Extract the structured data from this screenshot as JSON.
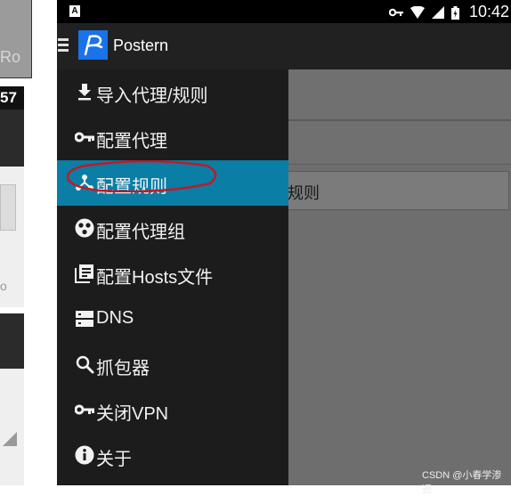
{
  "background_fragments": {
    "top_text": "Ro",
    "time_fragment": "57",
    "mid_text": "o"
  },
  "status_bar": {
    "notification_icon": "A",
    "icons": [
      "key-icon",
      "wifi-icon",
      "signal-icon",
      "battery-icon"
    ],
    "time": "10:42"
  },
  "app_bar": {
    "menu_icon": "hamburger-icon",
    "logo_icon": "postern-logo",
    "title": "Postern"
  },
  "drawer": {
    "items": [
      {
        "label": "导入代理/规则",
        "icon": "download-icon"
      },
      {
        "label": "配置代理",
        "icon": "key-icon"
      },
      {
        "label": "配置规则",
        "icon": "rules-icon",
        "selected": true
      },
      {
        "label": "配置代理组",
        "icon": "proxy-group-icon"
      },
      {
        "label": "配置Hosts文件",
        "icon": "hosts-file-icon"
      },
      {
        "label": "DNS",
        "icon": "dns-icon"
      },
      {
        "label": "抓包器",
        "icon": "search-icon"
      },
      {
        "label": "关闭VPN",
        "icon": "key-icon"
      },
      {
        "label": "关于",
        "icon": "info-icon"
      }
    ]
  },
  "background_content": {
    "rules_text": "规则"
  },
  "watermark": "CSDN @小春学渗透",
  "colors": {
    "selected_item": "#0a7ea4",
    "drawer_bg": "#1c1c1c",
    "app_bar": "#212121",
    "logo_blue": "#1a73e8",
    "annotation_red": "#c0192a"
  }
}
